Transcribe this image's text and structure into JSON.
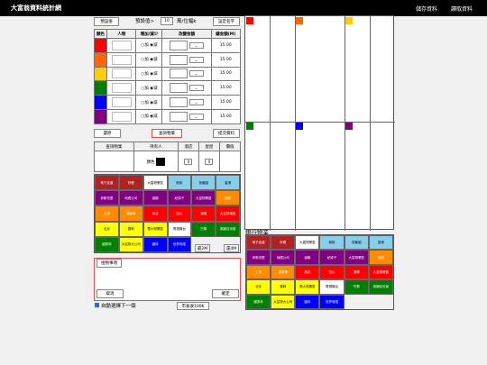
{
  "title": "大富翁資料統計網",
  "menu": [
    "儲存資料",
    "讀取資料"
  ],
  "toolbar": {
    "preset": "預設值",
    "setup_label": "預設值>",
    "setup_value": "10",
    "unit_label": "萬/位幅k",
    "name_btn": "設定名字"
  },
  "table_headers": [
    "顏色",
    "人物",
    "增加/減少",
    "改變金額",
    "總金額(M)"
  ],
  "radio_add": "加",
  "radio_sub": "減",
  "players": [
    {
      "color": "#ff0000",
      "total": "15.00"
    },
    {
      "color": "#ff6600",
      "total": "15.00"
    },
    {
      "color": "#ffcc00",
      "total": "15.00"
    },
    {
      "color": "#008000",
      "total": "15.00"
    },
    {
      "color": "#0000ff",
      "total": "15.00"
    },
    {
      "color": "#800080",
      "total": "15.00"
    }
  ],
  "actions": {
    "undo": "還原",
    "check_prop": "查詢物業",
    "submit": "提交資料"
  },
  "prop_headers": [
    "查詢物業",
    "持有人",
    "酒店",
    "屋屋",
    "價值"
  ],
  "prop_sub": {
    "color_label": "顏色",
    "hotel": "0",
    "house": "0"
  },
  "props": [
    {
      "t": "地下走道",
      "c": "#b22222",
      "w": 1
    },
    {
      "t": "好看",
      "c": "#b22222",
      "w": 1
    },
    {
      "t": "大嘉物業區",
      "c": "#ffffff",
      "w": 0
    },
    {
      "t": "新街",
      "c": "#87ceeb",
      "w": 0
    },
    {
      "t": "芭蕉園",
      "c": "#87ceeb",
      "w": 0
    },
    {
      "t": "香港",
      "c": "#87ceeb",
      "w": 0
    },
    {
      "t": "伊斯坦堡",
      "c": "#800080",
      "w": 1
    },
    {
      "t": "地鐵公司",
      "c": "#800080",
      "w": 1
    },
    {
      "t": "瀛鶴",
      "c": "#800080",
      "w": 1
    },
    {
      "t": "紀錄子",
      "c": "#800080",
      "w": 1
    },
    {
      "t": "大富物業區",
      "c": "#800080",
      "w": 1
    },
    {
      "t": "國家",
      "c": "#ff8c00",
      "w": 1
    },
    {
      "t": "上海",
      "c": "#ff8c00",
      "w": 1
    },
    {
      "t": "湯家華",
      "c": "#ff8c00",
      "w": 1
    },
    {
      "t": "黃花",
      "c": "#ff0000",
      "w": 1
    },
    {
      "t": "四川",
      "c": "#ff0000",
      "w": 1
    },
    {
      "t": "瀋陽",
      "c": "#ff0000",
      "w": 1
    },
    {
      "t": "大富物業區",
      "c": "#ff0000",
      "w": 1
    },
    {
      "t": "北京",
      "c": "#ffff00",
      "w": 0
    },
    {
      "t": "雪莉",
      "c": "#ffff00",
      "w": 0
    },
    {
      "t": "電大物業區",
      "c": "#ffff00",
      "w": 0
    },
    {
      "t": "電視機台",
      "c": "#ffffff",
      "w": 0
    },
    {
      "t": "巴黎",
      "c": "#008000",
      "w": 1
    },
    {
      "t": "英國佳世客",
      "c": "#008000",
      "w": 1
    },
    {
      "t": "國泰林",
      "c": "#008000",
      "w": 1
    },
    {
      "t": "大富物大公司",
      "c": "#ffff00",
      "w": 0
    },
    {
      "t": "國科",
      "c": "#0000ff",
      "w": 1
    },
    {
      "t": "世界有限",
      "c": "#0000ff",
      "w": 1
    },
    {
      "t": "",
      "c": "#f0f0f0",
      "w": 0
    },
    {
      "t": "",
      "c": "#f0f0f0",
      "w": 0
    }
  ],
  "mortgage": {
    "btn2m": "最2M",
    "btn4m": "還4M"
  },
  "lottery": {
    "title": "拾物事項",
    "cancel": "取消",
    "ok": "確定"
  },
  "auto_next": "自動選擇下一個",
  "market_btn": "市長收100K",
  "bank_label": "銀行物業"
}
